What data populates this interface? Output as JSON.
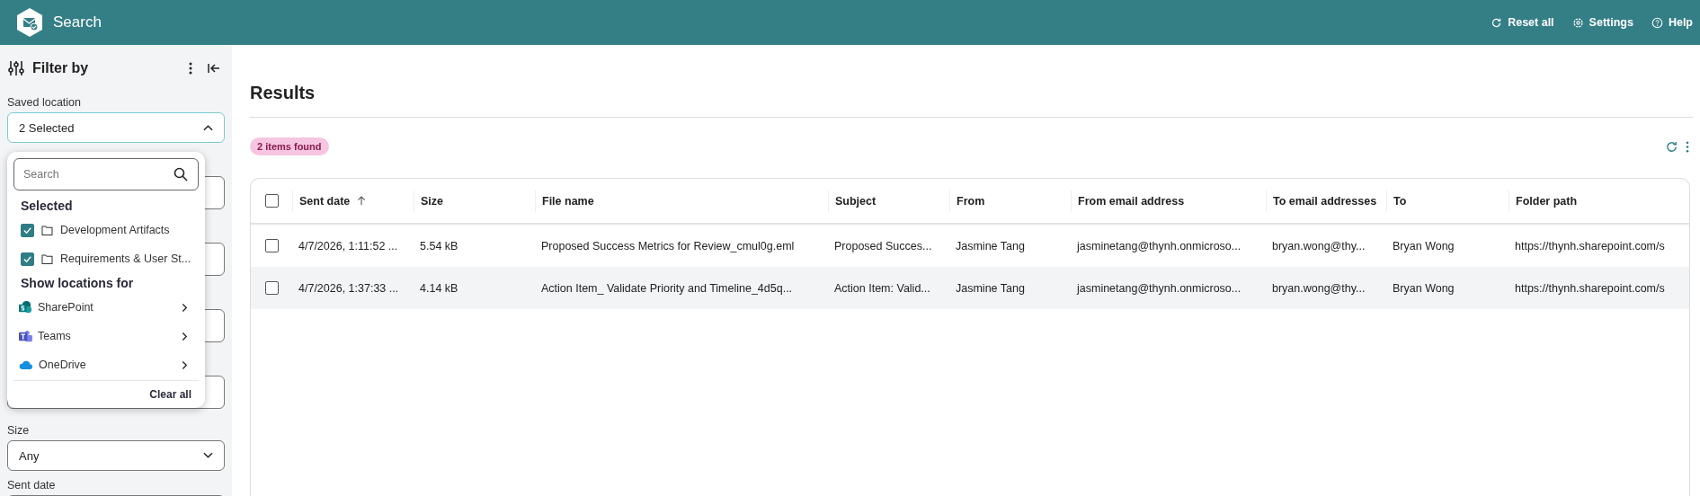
{
  "app_bar": {
    "title": "Search",
    "actions": [
      {
        "kind": "reset",
        "label": "Reset all"
      },
      {
        "kind": "settings",
        "label": "Settings"
      },
      {
        "kind": "help",
        "label": "Help"
      }
    ]
  },
  "sidebar": {
    "title": "Filter by",
    "saved_location": {
      "label": "Saved location",
      "value": "2 Selected",
      "expanded": true
    },
    "location_menu": {
      "search": {
        "placeholder": "Search"
      },
      "selected_heading": "Selected",
      "selected": [
        {
          "label": "Development Artifacts",
          "checked": true
        },
        {
          "label": "Requirements & User St...",
          "checked": true
        }
      ],
      "sources_heading": "Show locations for",
      "sources": [
        {
          "kind": "sharepoint",
          "label": "SharePoint"
        },
        {
          "kind": "teams",
          "label": "Teams"
        },
        {
          "kind": "onedrive",
          "label": "OneDrive"
        }
      ],
      "clear": "Clear all"
    },
    "filters": [
      {
        "label": "Size",
        "value": "Any"
      },
      {
        "label": "Sent date"
      }
    ]
  },
  "results": {
    "title": "Results",
    "count": "2 items found",
    "table": {
      "select_all": {
        "checked": false
      },
      "columns": [
        {
          "label": "Sent date",
          "sorted": true
        },
        {
          "label": "Size",
          "sorted": false
        },
        {
          "label": "File name",
          "sorted": false
        },
        {
          "label": "Subject",
          "sorted": false
        },
        {
          "label": "From",
          "sorted": false
        },
        {
          "label": "From email address",
          "sorted": false
        },
        {
          "label": "To email addresses",
          "sorted": false
        },
        {
          "label": "To",
          "sorted": false
        },
        {
          "label": "Folder path",
          "sorted": false
        }
      ],
      "rows": [
        {
          "checked": false,
          "cells": [
            "4/7/2026, 1:11:52 ...",
            "5.54 kB",
            "Proposed Success Metrics for Review_cmul0g.eml",
            "Proposed Succes...",
            "Jasmine Tang",
            "jasminetang@thynh.onmicroso...",
            "bryan.wong@thy...",
            "Bryan Wong",
            "https://thynh.sharepoint.com/s"
          ]
        },
        {
          "checked": false,
          "cells": [
            "4/7/2026, 1:37:33 ...",
            "4.14 kB",
            "Action Item_ Validate Priority and Timeline_4d5q...",
            "Action Item: Valid...",
            "Jasmine Tang",
            "jasminetang@thynh.onmicroso...",
            "bryan.wong@thy...",
            "Bryan Wong",
            "https://thynh.sharepoint.com/s"
          ]
        }
      ]
    }
  }
}
